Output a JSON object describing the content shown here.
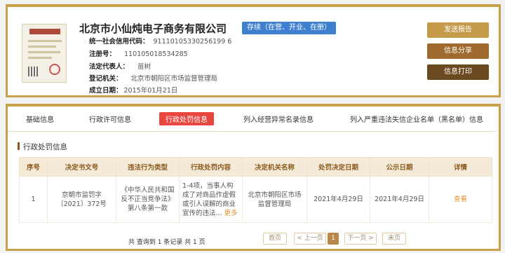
{
  "company": {
    "name": "北京市小仙炖电子商务有限公司",
    "status": "存续（在营、开业、在册）",
    "fields": [
      {
        "label": "统一社会信用代码：",
        "value": "91110105330256199 6"
      },
      {
        "label": "注册号：",
        "value": "110105018534285"
      },
      {
        "label": "法定代表人：",
        "value": "苗树"
      },
      {
        "label": "登记机关：",
        "value": "北京市朝阳区市场监督管理局"
      },
      {
        "label": "成立日期：",
        "value": "2015年01月21日"
      }
    ]
  },
  "actions": {
    "report": "发送报告",
    "share": "信息分享",
    "print": "信息打印"
  },
  "tabs": [
    "基础信息",
    "行政许可信息",
    "行政处罚信息",
    "列入经营异常名录信息",
    "列入严重违法失信企业名单（黑名单）信息"
  ],
  "section": {
    "title": "行政处罚信息"
  },
  "table": {
    "headers": [
      "序号",
      "决定书文号",
      "违法行为类型",
      "行政处罚内容",
      "决定机关名称",
      "处罚决定日期",
      "公示日期",
      "详情"
    ],
    "rows": [
      {
        "index": "1",
        "doc_no": "京朝市监罚字〔2021〕372号",
        "violation": "《中华人民共和国反不正当竞争法》第八条第一款",
        "content": "1-4项，当事人构成了对商品作虚假或引人误解的商业宣传的违法...",
        "more": "更多",
        "authority": "北京市朝阳区市场监督管理局",
        "decision_date": "2021年4月29日",
        "publish_date": "2021年4月29日",
        "detail": "查看"
      }
    ]
  },
  "pagination": {
    "summary": "共 查询到 1 条记录 共 1 页",
    "first": "首页",
    "prev": "< 上一页",
    "current": "1",
    "next": "下一页 >",
    "last": "末页"
  },
  "colors": {
    "border_gold": "#c8a24a",
    "status_blue": "#3f7fd0",
    "active_tab_red": "#e8463e",
    "header_bg": "#f5ead8",
    "link_orange": "#e0922e"
  }
}
